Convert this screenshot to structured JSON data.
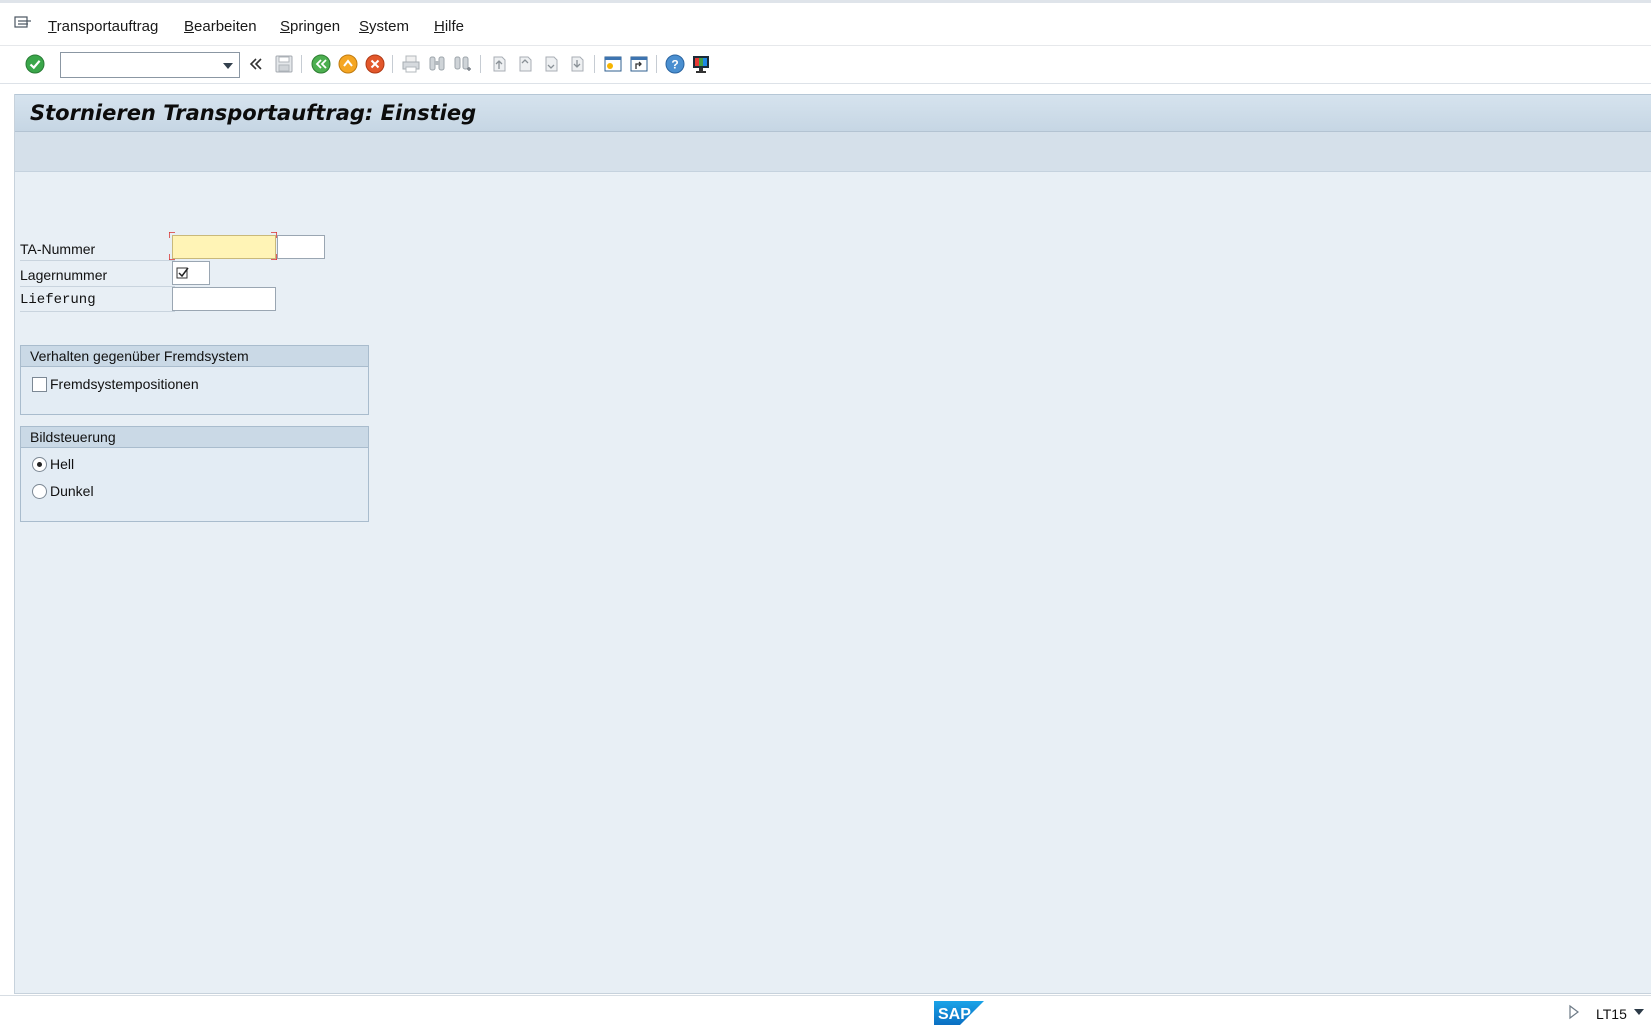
{
  "menu": {
    "items": [
      {
        "label": "Transportauftrag"
      },
      {
        "label": "Bearbeiten"
      },
      {
        "label": "Springen"
      },
      {
        "label": "System"
      },
      {
        "label": "Hilfe"
      }
    ]
  },
  "toolbar": {
    "command_field": {
      "value": "",
      "placeholder": ""
    },
    "icons": [
      "enter-icon",
      "double-chevron-left-icon",
      "save-icon",
      "back-icon",
      "exit-icon",
      "cancel-icon",
      "print-icon",
      "find-icon",
      "find-next-icon",
      "first-page-icon",
      "previous-page-icon",
      "next-page-icon",
      "last-page-icon",
      "create-session-icon",
      "create-shortcut-icon",
      "help-icon",
      "customize-layout-icon"
    ]
  },
  "page": {
    "title": "Stornieren Transportauftrag: Einstieg"
  },
  "form": {
    "ta_nummer": {
      "label": "TA-Nummer",
      "value": "",
      "value2": ""
    },
    "lagernummer": {
      "label": "Lagernummer",
      "value": ""
    },
    "lieferung": {
      "label": "Lieferung",
      "value": ""
    }
  },
  "group_fremdsystem": {
    "title": "Verhalten gegenüber Fremdsystem",
    "checkbox_label": "Fremdsystempositionen",
    "checked": false
  },
  "group_bildsteuerung": {
    "title": "Bildsteuerung",
    "options": [
      {
        "label": "Hell",
        "selected": true
      },
      {
        "label": "Dunkel",
        "selected": false
      }
    ]
  },
  "status": {
    "logo": "SAP",
    "system": "LT15"
  },
  "colors": {
    "main_bg": "#e8eff5",
    "title_bg": "#c6d6e4",
    "required_field": "#fff4b6"
  }
}
